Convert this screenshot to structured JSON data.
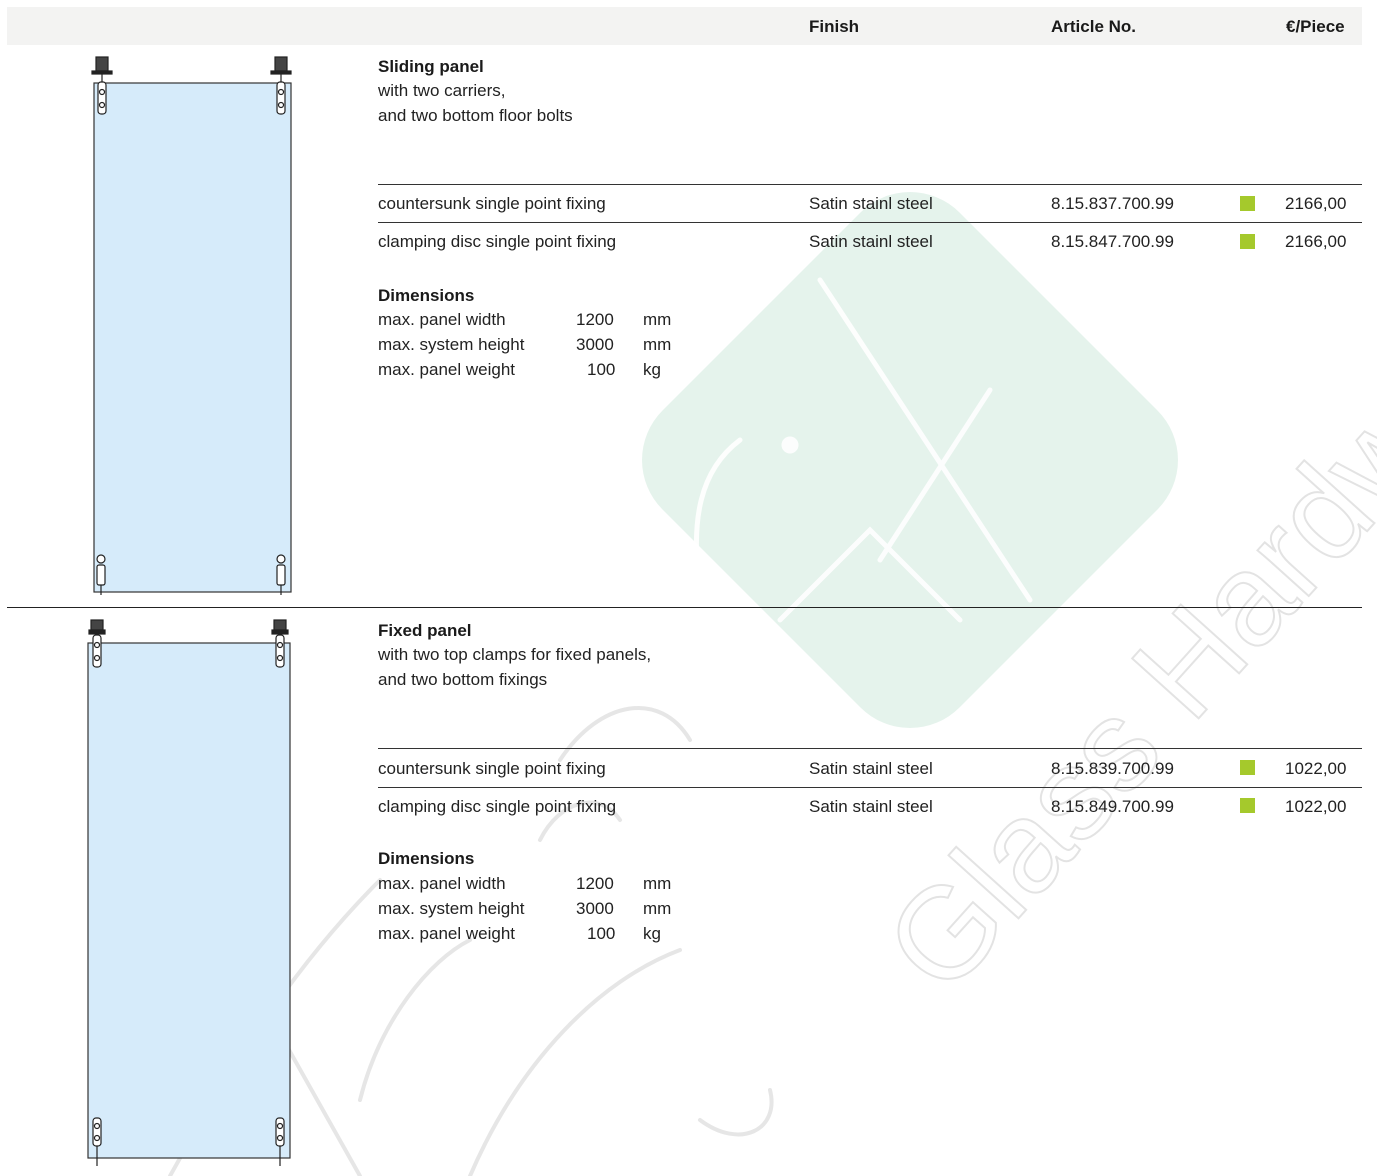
{
  "header": {
    "finish": "Finish",
    "article": "Article No.",
    "price": "€/Piece"
  },
  "colors": {
    "accent_green": "#a5c92c",
    "glass_fill": "#d6ebfa",
    "header_bg": "#f3f3f2",
    "watermark": "#d6ebe2"
  },
  "products": [
    {
      "title": "Sliding panel",
      "desc_lines": [
        "with two carriers,",
        "and two bottom floor bolts"
      ],
      "rows": [
        {
          "type": "countersunk single point fixing",
          "finish": "Satin stainl steel",
          "article": "8.15.837.700.99",
          "price": "2166,00"
        },
        {
          "type": "clamping disc single point fixing",
          "finish": "Satin stainl steel",
          "article": "8.15.847.700.99",
          "price": "2166,00"
        }
      ],
      "dimensions_title": "Dimensions",
      "dimensions": [
        {
          "label": "max. panel width",
          "value": "1200",
          "unit": "mm"
        },
        {
          "label": "max. system height",
          "value": "3000",
          "unit": "mm"
        },
        {
          "label": "max. panel weight",
          "value": "100",
          "unit": "kg"
        }
      ]
    },
    {
      "title": "Fixed panel",
      "desc_lines": [
        "with two top clamps for fixed panels,",
        "and two bottom fixings"
      ],
      "rows": [
        {
          "type": "countersunk single point fixing",
          "finish": "Satin stainl steel",
          "article": "8.15.839.700.99",
          "price": "1022,00"
        },
        {
          "type": "clamping disc single point fixing",
          "finish": "Satin stainl steel",
          "article": "8.15.849.700.99",
          "price": "1022,00"
        }
      ],
      "dimensions_title": "Dimensions",
      "dimensions": [
        {
          "label": "max. panel width",
          "value": "1200",
          "unit": "mm"
        },
        {
          "label": "max. system height",
          "value": "3000",
          "unit": "mm"
        },
        {
          "label": "max. panel weight",
          "value": "100",
          "unit": "kg"
        }
      ]
    }
  ],
  "watermark": {
    "text": "Glass Hardware",
    "logo_icon": "fix-logo-icon"
  }
}
